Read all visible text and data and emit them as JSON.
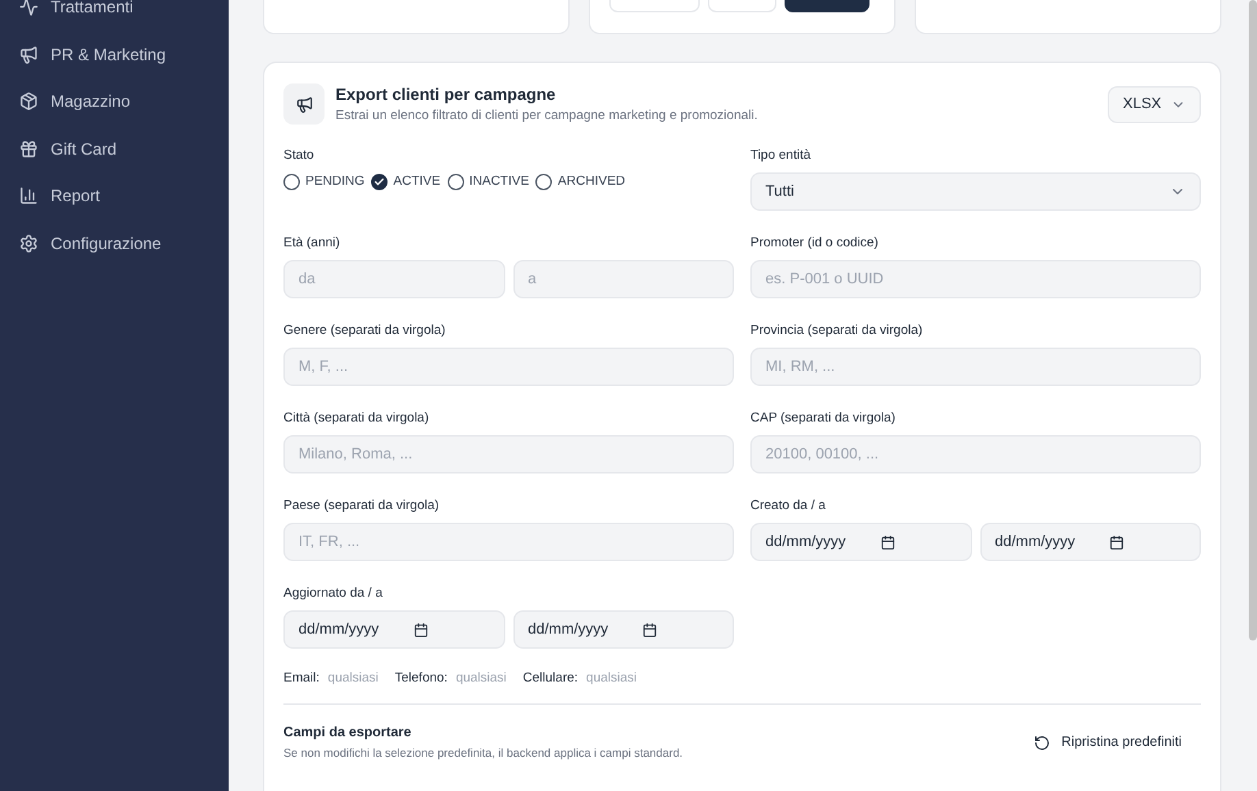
{
  "sidebar": {
    "items": [
      {
        "label": "Trattamenti"
      },
      {
        "label": "PR & Marketing"
      },
      {
        "label": "Magazzino"
      },
      {
        "label": "Gift Card"
      },
      {
        "label": "Report"
      },
      {
        "label": "Configurazione"
      }
    ]
  },
  "export_card": {
    "title": "Export clienti per campagne",
    "subtitle": "Estrai un elenco filtrato di clienti per campagne marketing e promozionali.",
    "format": {
      "value": "XLSX"
    },
    "filters": [
      {
        "kind": "checks",
        "label": "Stato",
        "options": [
          {
            "label": "PENDING",
            "checked": false
          },
          {
            "label": "ACTIVE",
            "checked": true
          },
          {
            "label": "INACTIVE",
            "checked": false
          },
          {
            "label": "ARCHIVED",
            "checked": false
          }
        ]
      },
      {
        "kind": "select",
        "label": "Tipo entità",
        "value": "Tutti"
      },
      {
        "kind": "range",
        "label": "Età (anni)",
        "inputs": [
          {
            "placeholder": "da"
          },
          {
            "placeholder": "a"
          }
        ]
      },
      {
        "kind": "text",
        "label": "Promoter (id o codice)",
        "placeholder": "es. P-001 o UUID"
      },
      {
        "kind": "text",
        "label": "Genere (separati da virgola)",
        "placeholder": "M, F, ..."
      },
      {
        "kind": "text",
        "label": "Provincia (separati da virgola)",
        "placeholder": "MI, RM, ..."
      },
      {
        "kind": "text",
        "label": "Città (separati da virgola)",
        "placeholder": "Milano, Roma, ..."
      },
      {
        "kind": "text",
        "label": "CAP (separati da virgola)",
        "placeholder": "20100, 00100, ..."
      },
      {
        "kind": "text",
        "label": "Paese (separati da virgola)",
        "placeholder": "IT, FR, ..."
      },
      {
        "kind": "dates",
        "label": "Creato da / a",
        "inputs": [
          {
            "value": "dd/mm/yyyy"
          },
          {
            "value": "dd/mm/yyyy"
          }
        ]
      },
      {
        "kind": "dates",
        "label": "Aggiornato da / a",
        "inputs": [
          {
            "value": "dd/mm/yyyy"
          },
          {
            "value": "dd/mm/yyyy"
          }
        ]
      }
    ],
    "contact_filters": [
      {
        "label": "Email:",
        "value": "qualsiasi"
      },
      {
        "label": "Telefono:",
        "value": "qualsiasi"
      },
      {
        "label": "Cellulare:",
        "value": "qualsiasi"
      }
    ],
    "fields_section": {
      "title": "Campi da esportare",
      "subtitle": "Se non modifichi la selezione predefinita, il backend applica i campi standard.",
      "reset_button": "Ripristina predefiniti"
    }
  }
}
